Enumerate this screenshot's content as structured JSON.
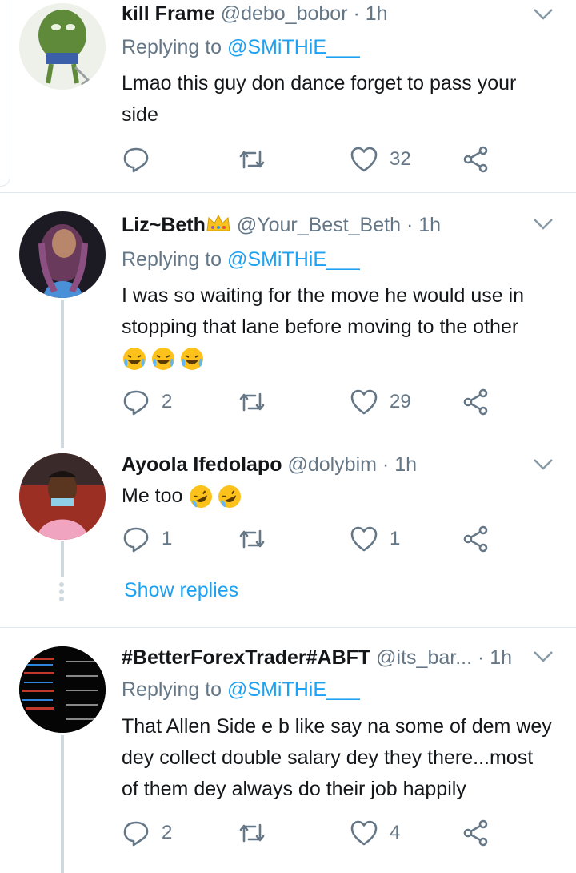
{
  "tweets": [
    {
      "name": "kill Frame",
      "handle": "@debo_bobor",
      "time": "· 1h",
      "replying_label": "Replying to",
      "replying_to": "@SMiTHiE___",
      "text": "Lmao this guy don dance forget to pass your side",
      "replies": "",
      "retweets": "",
      "likes": "32"
    },
    {
      "name": "Liz~Beth",
      "name_emoji": "crown-emoji",
      "handle": "@Your_Best_Beth",
      "time": "· 1h",
      "replying_label": "Replying to",
      "replying_to": "@SMiTHiE___",
      "text": "I was so waiting for the move he would use in stopping that lane before moving to the other",
      "text_emojis": [
        "laughing-crying-emoji",
        "laughing-crying-emoji",
        "laughing-crying-emoji"
      ],
      "replies": "2",
      "retweets": "",
      "likes": "29"
    },
    {
      "name": "Ayoola Ifedolapo",
      "handle": "@dolybim",
      "time": "· 1h",
      "text": "Me too",
      "text_emojis": [
        "rolling-laughing-emoji",
        "rolling-laughing-emoji"
      ],
      "replies": "1",
      "retweets": "",
      "likes": "1"
    },
    {
      "name": "#BetterForexTrader#ABFT",
      "handle": "@its_bar...",
      "time": "· 1h",
      "replying_label": "Replying to",
      "replying_to": "@SMiTHiE___",
      "text": "That Allen Side e b like say na some of dem wey dey collect double salary dey they there...most of them dey always do their job happily",
      "replies": "2",
      "retweets": "",
      "likes": "4"
    }
  ],
  "show_replies": "Show replies",
  "colors": {
    "accent": "#1da1f2",
    "muted": "#657786",
    "text": "#14171a",
    "divider": "#e1e8ed"
  }
}
